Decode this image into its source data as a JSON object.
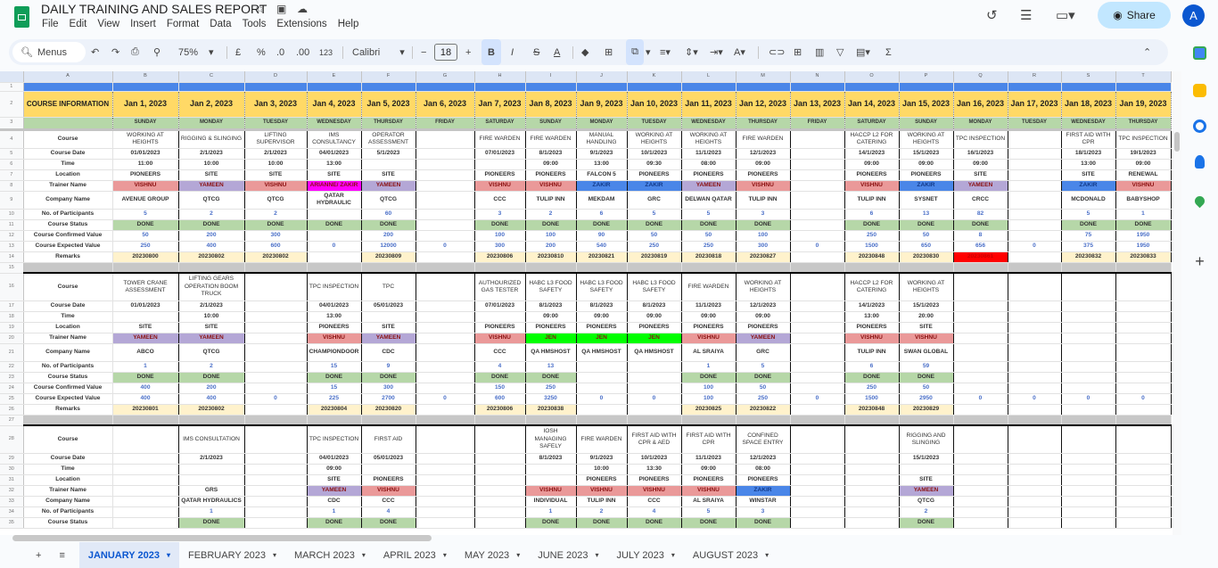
{
  "app": {
    "title": "DAILY TRAINING AND SALES REPORT",
    "menu": [
      "File",
      "Edit",
      "View",
      "Insert",
      "Format",
      "Data",
      "Tools",
      "Extensions",
      "Help"
    ],
    "share": "Share",
    "avatar": "A"
  },
  "toolbar": {
    "menus": "Menus",
    "zoom": "75%",
    "currency": "£",
    "percent": "%",
    "dec_less": ".0",
    "dec_more": ".00",
    "format": "123",
    "font": "Calibri",
    "font_size": "18",
    "bold": "B",
    "italic": "I",
    "strike": "S",
    "text_color": "A",
    "minus": "−",
    "plus": "+"
  },
  "columns": [
    "A",
    "B",
    "C",
    "D",
    "E",
    "F",
    "G",
    "H",
    "I",
    "J",
    "K",
    "L",
    "M",
    "N",
    "O",
    "P",
    "Q",
    "R",
    "S",
    "T"
  ],
  "header": {
    "course_info": "COURSE INFORMATION",
    "dates": [
      "Jan 1, 2023",
      "Jan 2, 2023",
      "Jan 3, 2023",
      "Jan 4, 2023",
      "Jan 5, 2023",
      "Jan 6, 2023",
      "Jan 7, 2023",
      "Jan 8, 2023",
      "Jan 9, 2023",
      "Jan 10, 2023",
      "Jan 11, 2023",
      "Jan 12, 2023",
      "Jan 13, 2023",
      "Jan 14, 2023",
      "Jan 15, 2023",
      "Jan 16, 2023",
      "Jan 17, 2023",
      "Jan 18, 2023",
      "Jan 19, 2023"
    ],
    "days": [
      "SUNDAY",
      "MONDAY",
      "TUESDAY",
      "WEDNESDAY",
      "THURSDAY",
      "FRIDAY",
      "SATURDAY",
      "SUNDAY",
      "MONDAY",
      "TUESDAY",
      "WEDNESDAY",
      "THURSDAY",
      "FRIDAY",
      "SATURDAY",
      "SUNDAY",
      "MONDAY",
      "TUESDAY",
      "WEDNESDAY",
      "THURSDAY"
    ]
  },
  "row_labels": [
    "Course",
    "Course Date",
    "Time",
    "Location",
    "Trainer Name",
    "Company Name",
    "No. of Participants",
    "Course Status",
    "Course Confirmed Value",
    "Course Expected Value",
    "Remarks"
  ],
  "trainer_colors": {
    "VISHNU": "#ea9999",
    "YAMEEN": "#b4a7d6",
    "ZAKIR": "#4a86e8",
    "JEN": "#00ff00",
    "ARIANNE/ ZAKIR": "#ff00ff"
  },
  "blocks": [
    {
      "course": [
        "WORKING AT HEIGHTS",
        "RIGGING & SLINGING",
        "LIFTING SUPERVISOR",
        "IMS CONSULTANCY",
        "OPERATOR ASSESSMENT",
        "",
        "FIRE WARDEN",
        "FIRE WARDEN",
        "MANUAL HANDLING",
        "WORKING AT HEIGHTS",
        "WORKING AT HEIGHTS",
        "FIRE WARDEN",
        "",
        "HACCP L2 FOR CATERING",
        "WORKING AT HEIGHTS",
        "TPC INSPECTION",
        "",
        "FIRST AID WITH CPR",
        "TPC INSPECTION"
      ],
      "date": [
        "01/01/2023",
        "2/1/2023",
        "2/1/2023",
        "04/01/2023",
        "5/1/2023",
        "",
        "07/01/2023",
        "8/1/2023",
        "9/1/2023",
        "10/1/2023",
        "11/1/2023",
        "12/1/2023",
        "",
        "14/1/2023",
        "15/1/2023",
        "16/1/2023",
        "",
        "18/1/2023",
        "19/1/2023"
      ],
      "time": [
        "11:00",
        "10:00",
        "10:00",
        "13:00",
        "",
        "",
        "",
        "09:00",
        "13:00",
        "09:30",
        "08:00",
        "09:00",
        "",
        "09:00",
        "09:00",
        "09:00",
        "",
        "13:00",
        "09:00"
      ],
      "location": [
        "PIONEERS",
        "SITE",
        "SITE",
        "SITE",
        "SITE",
        "",
        "PIONEERS",
        "PIONEERS",
        "FALCON 5",
        "PIONEERS",
        "PIONEERS",
        "PIONEERS",
        "",
        "PIONEERS",
        "PIONEERS",
        "SITE",
        "",
        "SITE",
        "RENEWAL"
      ],
      "trainer": [
        "VISHNU",
        "YAMEEN",
        "VISHNU",
        "ARIANNE/ ZAKIR",
        "YAMEEN",
        "",
        "VISHNU",
        "VISHNU",
        "ZAKIR",
        "ZAKIR",
        "YAMEEN",
        "VISHNU",
        "",
        "VISHNU",
        "ZAKIR",
        "YAMEEN",
        "",
        "ZAKIR",
        "VISHNU"
      ],
      "company": [
        "AVENUE GROUP",
        "QTCG",
        "QTCG",
        "QATAR HYDRAULIC",
        "QTCG",
        "",
        "CCC",
        "TULIP INN",
        "MEKDAM",
        "GRC",
        "DELWAN QATAR",
        "TULIP INN",
        "",
        "TULIP INN",
        "SYSNET",
        "CRCC",
        "",
        "MCDONALD",
        "BABYSHOP"
      ],
      "participants": [
        "5",
        "2",
        "2",
        "",
        "60",
        "",
        "3",
        "2",
        "6",
        "5",
        "5",
        "3",
        "",
        "6",
        "13",
        "82",
        "",
        "5",
        "1"
      ],
      "status": [
        "DONE",
        "DONE",
        "DONE",
        "DONE",
        "DONE",
        "",
        "DONE",
        "DONE",
        "DONE",
        "DONE",
        "DONE",
        "DONE",
        "",
        "DONE",
        "DONE",
        "DONE",
        "",
        "DONE",
        "DONE"
      ],
      "confirmed": [
        "50",
        "200",
        "300",
        "",
        "200",
        "",
        "100",
        "100",
        "90",
        "50",
        "50",
        "100",
        "",
        "250",
        "50",
        "8",
        "",
        "75",
        "1950"
      ],
      "expected": [
        "250",
        "400",
        "600",
        "0",
        "12000",
        "0",
        "300",
        "200",
        "540",
        "250",
        "250",
        "300",
        "0",
        "1500",
        "650",
        "656",
        "0",
        "375",
        "1950"
      ],
      "remarks": [
        "20230800",
        "20230802",
        "20230802",
        "",
        "20230809",
        "",
        "20230806",
        "20230810",
        "20230821",
        "20230819",
        "20230818",
        "20230827",
        "",
        "20230848",
        "20230830",
        "20230861",
        "",
        "20230832",
        "20230833"
      ]
    },
    {
      "course": [
        "TOWER CRANE ASSESSMENT",
        "LIFTING GEARS OPERATION BOOM TRUCK",
        "",
        "TPC INSPECTION",
        "TPC",
        "",
        "AUTHOURIZED GAS TESTER",
        "HABC L3 FOOD SAFETY",
        "HABC L3 FOOD SAFETY",
        "HABC L3 FOOD SAFETY",
        "FIRE WARDEN",
        "WORKING AT HEIGHTS",
        "",
        "HACCP L2 FOR CATERING",
        "WORKING AT HEIGHTS",
        "",
        "",
        "",
        ""
      ],
      "date": [
        "01/01/2023",
        "2/1/2023",
        "",
        "04/01/2023",
        "05/01/2023",
        "",
        "07/01/2023",
        "8/1/2023",
        "8/1/2023",
        "8/1/2023",
        "11/1/2023",
        "12/1/2023",
        "",
        "14/1/2023",
        "15/1/2023",
        "",
        "",
        "",
        ""
      ],
      "time": [
        "",
        "10:00",
        "",
        "13:00",
        "",
        "",
        "",
        "09:00",
        "09:00",
        "09:00",
        "09:00",
        "09:00",
        "",
        "13:00",
        "20:00",
        "",
        "",
        "",
        ""
      ],
      "location": [
        "SITE",
        "SITE",
        "",
        "PIONEERS",
        "SITE",
        "",
        "PIONEERS",
        "PIONEERS",
        "PIONEERS",
        "PIONEERS",
        "PIONEERS",
        "PIONEERS",
        "",
        "PIONEERS",
        "SITE",
        "",
        "",
        "",
        ""
      ],
      "trainer": [
        "YAMEEN",
        "YAMEEN",
        "",
        "VISHNU",
        "YAMEEN",
        "",
        "VISHNU",
        "JEN",
        "JEN",
        "JEN",
        "VISHNU",
        "YAMEEN",
        "",
        "VISHNU",
        "VISHNU",
        "",
        "",
        "",
        ""
      ],
      "company": [
        "ABCO",
        "QTCG",
        "",
        "CHAMPIONDOOR",
        "CDC",
        "",
        "CCC",
        "QA HMSHOST",
        "QA HMSHOST",
        "QA HMSHOST",
        "AL SRAIYA",
        "GRC",
        "",
        "TULIP INN",
        "SWAN GLOBAL",
        "",
        "",
        "",
        ""
      ],
      "participants": [
        "1",
        "2",
        "",
        "15",
        "9",
        "",
        "4",
        "13",
        "",
        "",
        "1",
        "5",
        "",
        "6",
        "59",
        "",
        "",
        "",
        ""
      ],
      "status": [
        "DONE",
        "DONE",
        "",
        "DONE",
        "DONE",
        "",
        "DONE",
        "DONE",
        "",
        "",
        "DONE",
        "DONE",
        "",
        "DONE",
        "DONE",
        "",
        "",
        "",
        ""
      ],
      "confirmed": [
        "400",
        "200",
        "",
        "15",
        "300",
        "",
        "150",
        "250",
        "",
        "",
        "100",
        "50",
        "",
        "250",
        "50",
        "",
        "",
        "",
        ""
      ],
      "expected": [
        "400",
        "400",
        "0",
        "225",
        "2700",
        "0",
        "600",
        "3250",
        "0",
        "0",
        "100",
        "250",
        "0",
        "1500",
        "2950",
        "0",
        "0",
        "0",
        "0"
      ],
      "remarks": [
        "20230801",
        "20230802",
        "",
        "20230804",
        "20230820",
        "",
        "20230806",
        "20230838",
        "",
        "",
        "20230825",
        "20230822",
        "",
        "20230848",
        "20230829",
        "",
        "",
        "",
        ""
      ]
    },
    {
      "course": [
        "",
        "IMS CONSULTATION",
        "",
        "TPC INSPECTION",
        "FIRST AID",
        "",
        "",
        "IOSH MANAGING SAFELY",
        "FIRE WARDEN",
        "FIRST AID WITH CPR & AED",
        "FIRST AID WITH CPR",
        "CONFINED SPACE ENTRY",
        "",
        "",
        "RIGGING AND SLINGING",
        "",
        "",
        "",
        ""
      ],
      "date": [
        "",
        "2/1/2023",
        "",
        "04/01/2023",
        "05/01/2023",
        "",
        "",
        "8/1/2023",
        "9/1/2023",
        "10/1/2023",
        "11/1/2023",
        "12/1/2023",
        "",
        "",
        "15/1/2023",
        "",
        "",
        "",
        ""
      ],
      "time": [
        "",
        "",
        "",
        "09:00",
        "",
        "",
        "",
        "",
        "10:00",
        "13:30",
        "09:00",
        "08:00",
        "",
        "",
        "",
        "",
        "",
        "",
        ""
      ],
      "location": [
        "",
        "",
        "",
        "SITE",
        "PIONEERS",
        "",
        "",
        "",
        "PIONEERS",
        "PIONEERS",
        "PIONEERS",
        "PIONEERS",
        "",
        "",
        "SITE",
        "",
        "",
        "",
        ""
      ],
      "trainer": [
        "",
        "GRS",
        "",
        "YAMEEN",
        "VISHNU",
        "",
        "",
        "VISHNU",
        "VISHNU",
        "VISHNU",
        "VISHNU",
        "ZAKIR",
        "",
        "",
        "YAMEEN",
        "",
        "",
        "",
        ""
      ],
      "company": [
        "",
        "QATAR HYDRAULICS",
        "",
        "CDC",
        "CCC",
        "",
        "",
        "INDIVIDUAL",
        "TULIP INN",
        "CCC",
        "AL SRAIYA",
        "WINSTAR",
        "",
        "",
        "QTCG",
        "",
        "",
        "",
        ""
      ],
      "participants": [
        "",
        "1",
        "",
        "1",
        "4",
        "",
        "",
        "1",
        "2",
        "4",
        "5",
        "3",
        "",
        "",
        "2",
        "",
        "",
        "",
        ""
      ],
      "status": [
        "",
        "DONE",
        "",
        "DONE",
        "DONE",
        "",
        "",
        "DONE",
        "DONE",
        "DONE",
        "DONE",
        "DONE",
        "",
        "",
        "DONE",
        "",
        "",
        "",
        ""
      ]
    }
  ],
  "sheet_tabs": [
    "JANUARY 2023",
    "FEBRUARY 2023",
    "MARCH 2023",
    "APRIL 2023",
    "MAY 2023",
    "JUNE 2023",
    "JULY 2023",
    "AUGUST 2023"
  ]
}
